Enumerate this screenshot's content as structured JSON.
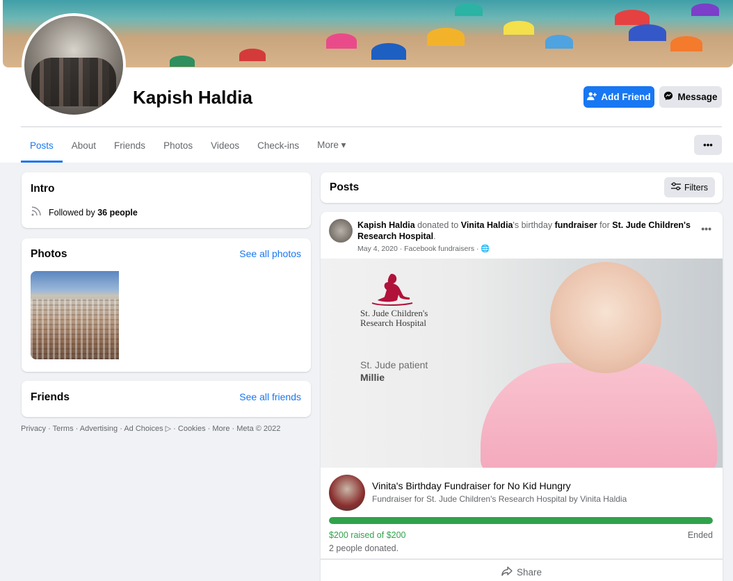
{
  "profile": {
    "name": "Kapish Haldia",
    "add_friend_label": "Add Friend",
    "message_label": "Message"
  },
  "tabs": [
    "Posts",
    "About",
    "Friends",
    "Photos",
    "Videos",
    "Check-ins",
    "More ▾"
  ],
  "intro": {
    "title": "Intro",
    "followed_prefix": "Followed by ",
    "followed_count": "36 people"
  },
  "photos": {
    "title": "Photos",
    "see_all": "See all photos"
  },
  "friends": {
    "title": "Friends",
    "see_all": "See all friends"
  },
  "footer": "Privacy · Terms · Advertising · Ad Choices ▷ · Cookies · More · Meta © 2022",
  "posts": {
    "title": "Posts",
    "filters_label": "Filters"
  },
  "post": {
    "author": "Kapish Haldia",
    "text_donated": " donated to ",
    "recipient": "Vinita Haldia",
    "text_birthday": "'s birthday ",
    "fundraiser_word": "fundraiser",
    "text_for": " for ",
    "org": "St. Jude Children's Research Hospital",
    "period": ".",
    "meta": "May 4, 2020 · Facebook fundraisers · 🌐",
    "banner": {
      "brand_line1": "St. Jude Children's",
      "brand_line2": "Research Hospital",
      "patient_line": "St. Jude patient",
      "patient_name": "Millie"
    },
    "fundraiser": {
      "title": "Vinita's Birthday Fundraiser for No Kid Hungry",
      "subtitle": "Fundraiser for St. Jude Children's Research Hospital by Vinita Haldia",
      "progress_fraction": 1.0,
      "raised": "$200 raised of $200",
      "status": "Ended",
      "donors": "2 people donated."
    },
    "share_label": "Share"
  },
  "colors": {
    "accent": "#1877f2",
    "progress": "#31a24c",
    "background": "#f0f2f5"
  }
}
